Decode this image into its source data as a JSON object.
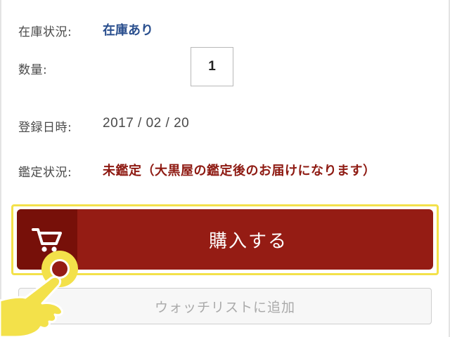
{
  "product_details": {
    "stock": {
      "label": "在庫状況:",
      "value": "在庫あり"
    },
    "quantity": {
      "label": "数量:",
      "value": "1"
    },
    "registered": {
      "label": "登録日時:",
      "value": "2017 / 02 / 20"
    },
    "appraisal": {
      "label": "鑑定状況:",
      "value": "未鑑定（大黒屋の鑑定後のお届けになります）"
    }
  },
  "actions": {
    "buy_label": "購入する",
    "buy_icon": "cart-icon",
    "watchlist_label": "ウォッチリストに追加"
  },
  "tutorial": {
    "pointer_icon": "pointing-hand-icon",
    "highlight_color": "#f3e14a"
  },
  "colors": {
    "accent_red": "#951c14",
    "stock_blue": "#2a4f8e",
    "appraisal_red": "#8e1a12"
  }
}
